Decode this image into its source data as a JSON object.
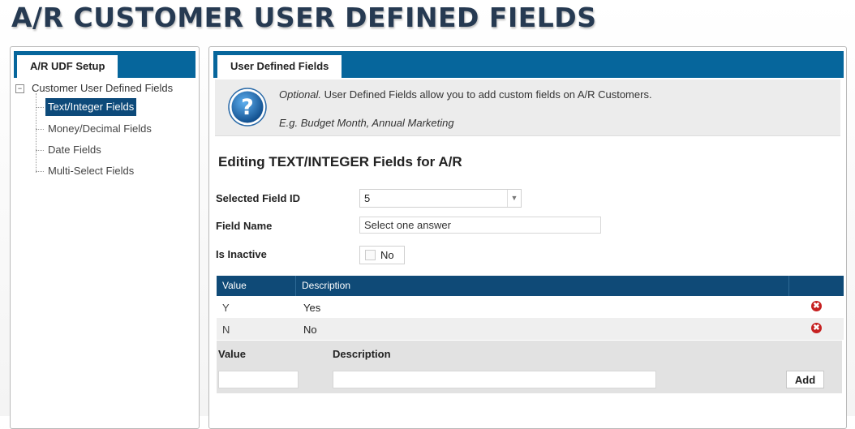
{
  "page": {
    "title": "A/R CUSTOMER USER DEFINED FIELDS"
  },
  "left_panel": {
    "tab": "A/R UDF Setup",
    "tree": {
      "root_expander": "−",
      "root_label": "Customer User Defined Fields",
      "items": [
        {
          "label": "Text/Integer Fields",
          "selected": true
        },
        {
          "label": "Money/Decimal Fields",
          "selected": false
        },
        {
          "label": "Date Fields",
          "selected": false
        },
        {
          "label": "Multi-Select Fields",
          "selected": false
        }
      ]
    }
  },
  "right_panel": {
    "tab": "User Defined Fields",
    "info": {
      "icon": "question-mark-icon",
      "optional": "Optional.",
      "text": " User Defined Fields allow you to add custom fields on A/R Customers.",
      "example": "E.g. Budget Month, Annual Marketing"
    },
    "heading": "Editing TEXT/INTEGER Fields for A/R",
    "form": {
      "selected_field_id_label": "Selected Field ID",
      "selected_field_id_value": "5",
      "field_name_label": "Field Name",
      "field_name_value": "Select one answer",
      "is_inactive_label": "Is Inactive",
      "is_inactive_value": "No"
    },
    "grid": {
      "headers": {
        "value": "Value",
        "description": "Description"
      },
      "rows": [
        {
          "value": "Y",
          "description": "Yes"
        },
        {
          "value": "N",
          "description": "No"
        }
      ],
      "delete_icon": "✖"
    },
    "add_row": {
      "value_label": "Value",
      "description_label": "Description",
      "value_input": "",
      "description_input": "",
      "add_button": "Add"
    }
  },
  "colors": {
    "tab_bar": "#06669c",
    "grid_header": "#0f4a77",
    "selected_tree_item": "#0d4a7a",
    "delete_icon": "#c62121",
    "help_icon": "#1b6fb3"
  }
}
